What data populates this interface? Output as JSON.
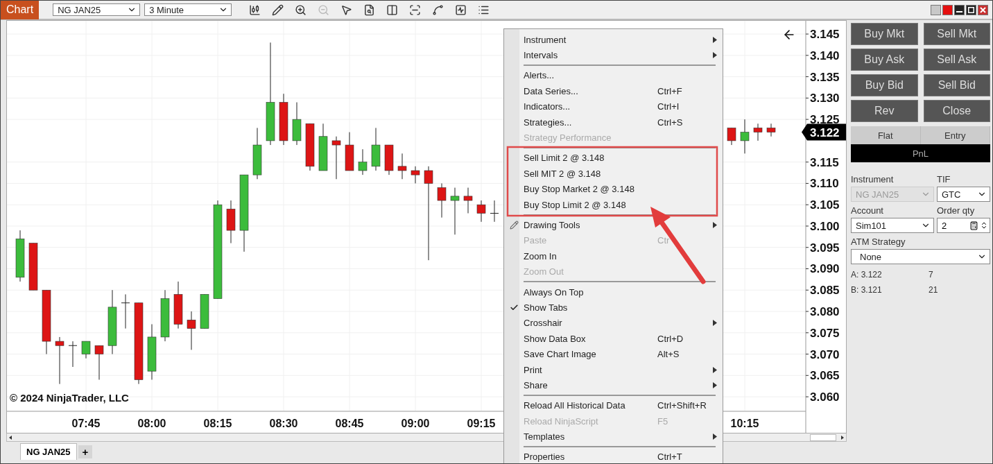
{
  "title_bar": {
    "app_tab": "Chart",
    "instrument": "NG JAN25",
    "interval": "3 Minute",
    "toolbar": [
      {
        "disabled": false
      },
      {
        "disabled": false
      },
      {
        "disabled": false
      },
      {
        "disabled": true
      },
      {
        "disabled": false
      },
      {
        "disabled": false
      },
      {
        "disabled": false
      },
      {
        "disabled": false
      },
      {
        "disabled": false
      },
      {
        "disabled": false
      },
      {
        "disabled": false
      }
    ]
  },
  "chart": {
    "copyright": "© 2024 NinjaTrader, LLC",
    "last_price": "3.122",
    "chart_data": {
      "type": "candlestick",
      "grid": true,
      "ylim": [
        3.0566,
        3.1481
      ],
      "categories": [
        null,
        null,
        null,
        null,
        null,
        "07:45",
        null,
        null,
        null,
        null,
        "08:00",
        null,
        null,
        null,
        null,
        "08:15",
        null,
        null,
        null,
        null,
        "08:30",
        null,
        null,
        null,
        null,
        "08:45",
        null,
        null,
        null,
        null,
        "09:00",
        null,
        null,
        null,
        null,
        "09:15",
        null,
        null,
        null,
        null,
        null,
        null,
        null,
        null,
        null,
        null,
        null,
        null,
        null,
        null,
        null,
        null,
        null,
        null,
        null,
        "10:15",
        null,
        null
      ],
      "yticks": [
        {
          "value": 3.145,
          "label": "3.145"
        },
        {
          "value": 3.14,
          "label": "3.140"
        },
        {
          "value": 3.135,
          "label": "3.135"
        },
        {
          "value": 3.13,
          "label": "3.130"
        },
        {
          "value": 3.125,
          "label": "3.125"
        },
        {
          "value": 3.115,
          "label": "3.115"
        },
        {
          "value": 3.11,
          "label": "3.110"
        },
        {
          "value": 3.105,
          "label": "3.105"
        },
        {
          "value": 3.1,
          "label": "3.100"
        },
        {
          "value": 3.095,
          "label": "3.095"
        },
        {
          "value": 3.09,
          "label": "3.090"
        },
        {
          "value": 3.085,
          "label": "3.085"
        },
        {
          "value": 3.08,
          "label": "3.080"
        },
        {
          "value": 3.075,
          "label": "3.075"
        },
        {
          "value": 3.07,
          "label": "3.070"
        },
        {
          "value": 3.065,
          "label": "3.065"
        },
        {
          "value": 3.06,
          "label": "3.060"
        }
      ],
      "ohlc": [
        [
          3.088,
          3.099,
          3.087,
          3.097
        ],
        [
          3.096,
          3.096,
          3.085,
          3.085
        ],
        [
          3.085,
          3.085,
          3.07,
          3.073
        ],
        [
          3.073,
          3.074,
          3.063,
          3.072
        ],
        [
          3.072,
          3.073,
          3.067,
          3.072
        ],
        [
          3.07,
          3.073,
          3.069,
          3.073
        ],
        [
          3.072,
          3.072,
          3.064,
          3.07
        ],
        [
          3.072,
          3.085,
          3.07,
          3.081
        ],
        [
          3.082,
          3.084,
          3.076,
          3.082
        ],
        [
          3.082,
          3.082,
          3.063,
          3.064
        ],
        [
          3.066,
          3.077,
          3.064,
          3.074
        ],
        [
          3.074,
          3.085,
          3.073,
          3.083
        ],
        [
          3.084,
          3.087,
          3.076,
          3.077
        ],
        [
          3.078,
          3.08,
          3.071,
          3.076
        ],
        [
          3.076,
          3.084,
          3.076,
          3.084
        ],
        [
          3.083,
          3.106,
          3.083,
          3.105
        ],
        [
          3.104,
          3.106,
          3.096,
          3.099
        ],
        [
          3.099,
          3.112,
          3.094,
          3.112
        ],
        [
          3.112,
          3.123,
          3.111,
          3.119
        ],
        [
          3.12,
          3.143,
          3.119,
          3.129
        ],
        [
          3.129,
          3.131,
          3.119,
          3.12
        ],
        [
          3.12,
          3.129,
          3.119,
          3.125
        ],
        [
          3.124,
          3.124,
          3.113,
          3.114
        ],
        [
          3.113,
          3.124,
          3.113,
          3.121
        ],
        [
          3.12,
          3.121,
          3.111,
          3.119
        ],
        [
          3.119,
          3.122,
          3.113,
          3.113
        ],
        [
          3.113,
          3.118,
          3.112,
          3.115
        ],
        [
          3.114,
          3.123,
          3.113,
          3.119
        ],
        [
          3.119,
          3.119,
          3.112,
          3.113
        ],
        [
          3.114,
          3.117,
          3.111,
          3.113
        ],
        [
          3.113,
          3.114,
          3.11,
          3.112
        ],
        [
          3.113,
          3.114,
          3.092,
          3.11
        ],
        [
          3.109,
          3.11,
          3.102,
          3.106
        ],
        [
          3.106,
          3.109,
          3.098,
          3.107
        ],
        [
          3.107,
          3.109,
          3.103,
          3.106
        ],
        [
          3.105,
          3.106,
          3.101,
          3.103
        ],
        [
          3.103,
          3.106,
          3.101,
          3.103
        ],
        null,
        null,
        null,
        null,
        null,
        null,
        null,
        null,
        null,
        null,
        null,
        null,
        null,
        null,
        null,
        null,
        null,
        [
          3.123,
          3.123,
          3.119,
          3.12
        ],
        [
          3.12,
          3.125,
          3.117,
          3.122
        ],
        [
          3.123,
          3.124,
          3.12,
          3.122
        ],
        [
          3.123,
          3.124,
          3.121,
          3.122
        ]
      ]
    }
  },
  "tabs": [
    {
      "label": "NG JAN25",
      "selected": true
    }
  ],
  "add_tab": "+",
  "context_menu": [
    {
      "kind": "item",
      "label": "Instrument",
      "submenu": true,
      "disabled": false,
      "checked": false
    },
    {
      "kind": "item",
      "label": "Intervals",
      "submenu": true,
      "disabled": false,
      "checked": false
    },
    {
      "kind": "separator"
    },
    {
      "kind": "item",
      "label": "Alerts...",
      "submenu": false,
      "disabled": false,
      "checked": false
    },
    {
      "kind": "item",
      "label": "Data Series...",
      "shortcut": "Ctrl+F",
      "submenu": false,
      "disabled": false,
      "checked": false
    },
    {
      "kind": "item",
      "label": "Indicators...",
      "shortcut": "Ctrl+I",
      "submenu": false,
      "disabled": false,
      "checked": false
    },
    {
      "kind": "item",
      "label": "Strategies...",
      "shortcut": "Ctrl+S",
      "submenu": false,
      "disabled": false,
      "checked": false
    },
    {
      "kind": "item",
      "label": "Strategy Performance",
      "submenu": false,
      "disabled": true,
      "checked": false
    },
    {
      "kind": "separator"
    },
    {
      "kind": "item",
      "label": "Sell Limit 2 @ 3.148",
      "submenu": false,
      "disabled": false,
      "checked": false
    },
    {
      "kind": "item",
      "label": "Sell MIT 2 @ 3.148",
      "submenu": false,
      "disabled": false,
      "checked": false
    },
    {
      "kind": "item",
      "label": "Buy Stop Market 2 @ 3.148",
      "submenu": false,
      "disabled": false,
      "checked": false
    },
    {
      "kind": "item",
      "label": "Buy Stop Limit 2 @ 3.148",
      "submenu": false,
      "disabled": false,
      "checked": false
    },
    {
      "kind": "separator"
    },
    {
      "kind": "tool-item",
      "label": "Drawing Tools",
      "submenu": true,
      "disabled": false,
      "checked": false
    },
    {
      "kind": "item",
      "label": "Paste",
      "shortcut": "Ctr",
      "submenu": false,
      "disabled": true,
      "checked": false
    },
    {
      "kind": "item",
      "label": "Zoom In",
      "submenu": false,
      "disabled": false,
      "checked": false
    },
    {
      "kind": "item",
      "label": "Zoom Out",
      "submenu": false,
      "disabled": true,
      "checked": false
    },
    {
      "kind": "separator"
    },
    {
      "kind": "item",
      "label": "Always On Top",
      "submenu": false,
      "disabled": false,
      "checked": false
    },
    {
      "kind": "item",
      "label": "Show Tabs",
      "submenu": false,
      "disabled": false,
      "checked": true
    },
    {
      "kind": "item",
      "label": "Crosshair",
      "submenu": true,
      "disabled": false,
      "checked": false
    },
    {
      "kind": "item",
      "label": "Show Data Box",
      "shortcut": "Ctrl+D",
      "submenu": false,
      "disabled": false,
      "checked": false
    },
    {
      "kind": "item",
      "label": "Save Chart Image",
      "shortcut": "Alt+S",
      "submenu": false,
      "disabled": false,
      "checked": false
    },
    {
      "kind": "item",
      "label": "Print",
      "submenu": true,
      "disabled": false,
      "checked": false
    },
    {
      "kind": "item",
      "label": "Share",
      "submenu": true,
      "disabled": false,
      "checked": false
    },
    {
      "kind": "separator"
    },
    {
      "kind": "item",
      "label": "Reload All Historical Data",
      "shortcut": "Ctrl+Shift+R",
      "submenu": false,
      "disabled": false,
      "checked": false
    },
    {
      "kind": "item",
      "label": "Reload NinjaScript",
      "shortcut": "F5",
      "submenu": false,
      "disabled": true,
      "checked": false
    },
    {
      "kind": "item",
      "label": "Templates",
      "submenu": true,
      "disabled": false,
      "checked": false
    },
    {
      "kind": "separator"
    },
    {
      "kind": "item",
      "label": "Properties",
      "shortcut": "Ctrl+T",
      "submenu": false,
      "disabled": false,
      "checked": false
    }
  ],
  "order_panel": {
    "buttons": [
      "Buy Mkt",
      "Sell Mkt",
      "Buy Ask",
      "Sell Ask",
      "Buy Bid",
      "Sell Bid",
      "Rev",
      "Close"
    ],
    "position_header": [
      "Flat",
      "Entry"
    ],
    "pnl": "PnL",
    "instrument": {
      "label": "Instrument",
      "value": "NG JAN25",
      "disabled": true
    },
    "tif": {
      "label": "TIF",
      "value": "GTC"
    },
    "account": {
      "label": "Account",
      "value": "Sim101"
    },
    "order_qty": {
      "label": "Order qty",
      "value": "2"
    },
    "atm_strategy": {
      "label": "ATM Strategy",
      "value": "None"
    },
    "quotes": [
      {
        "side": "A:",
        "price": "3.122",
        "size": "7"
      },
      {
        "side": "B:",
        "price": "3.121",
        "size": "21"
      }
    ]
  }
}
